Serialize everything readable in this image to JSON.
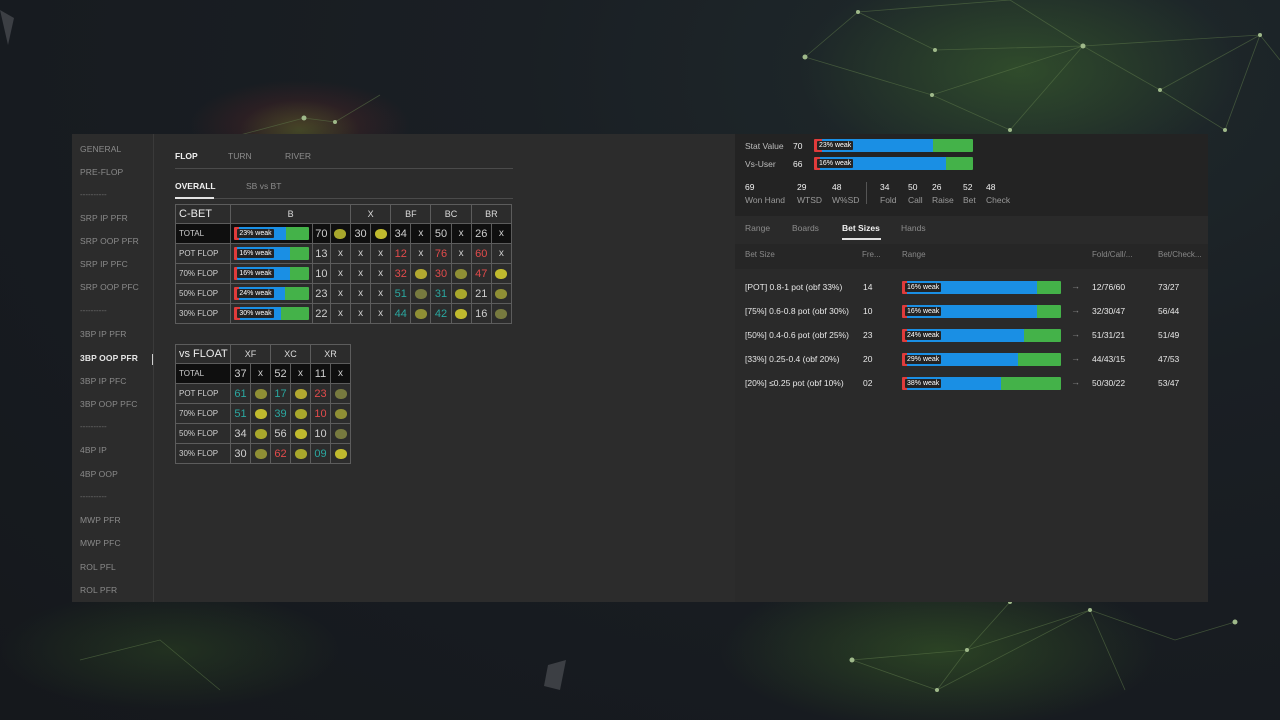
{
  "sidebar": {
    "items": [
      {
        "label": "GENERAL",
        "active": false
      },
      {
        "label": "PRE-FLOP",
        "active": false
      },
      {
        "label": "----------",
        "separator": true
      },
      {
        "label": "SRP IP PFR",
        "active": false
      },
      {
        "label": "SRP OOP PFR",
        "active": false
      },
      {
        "label": "SRP IP PFC",
        "active": false
      },
      {
        "label": "SRP OOP PFC",
        "active": false
      },
      {
        "label": "----------",
        "separator": true
      },
      {
        "label": "3BP IP PFR",
        "active": false
      },
      {
        "label": "3BP OOP PFR",
        "active": true
      },
      {
        "label": "3BP IP PFC",
        "active": false
      },
      {
        "label": "3BP OOP PFC",
        "active": false
      },
      {
        "label": "----------",
        "separator": true
      },
      {
        "label": "4BP IP",
        "active": false
      },
      {
        "label": "4BP OOP",
        "active": false
      },
      {
        "label": "----------",
        "separator": true
      },
      {
        "label": "MWP PFR",
        "active": false
      },
      {
        "label": "MWP PFC",
        "active": false
      },
      {
        "label": "ROL PFL",
        "active": false
      },
      {
        "label": "ROL PFR",
        "active": false
      }
    ]
  },
  "street_tabs": [
    "FLOP",
    "TURN",
    "RIVER"
  ],
  "active_street": "FLOP",
  "sub_tabs": [
    "OVERALL",
    "SB vs BT"
  ],
  "active_sub_tab": "OVERALL",
  "cbet_table": {
    "title": "C-BET",
    "headers": [
      "B",
      "X",
      "BF",
      "BC",
      "BR"
    ],
    "rows": [
      {
        "label": "TOTAL",
        "bar": {
          "text": "23% weak",
          "red": 0.06,
          "blue": 0.63
        },
        "b": "70",
        "x": "30",
        "bf": "34",
        "bc": "50",
        "br": "26"
      },
      {
        "label": "POT FLOP",
        "bar": {
          "text": "16% weak",
          "red": 0.04,
          "blue": 0.71
        },
        "b": "13",
        "x": "x",
        "bf": "12",
        "bc": "76",
        "br": "60"
      },
      {
        "label": "70% FLOP",
        "bar": {
          "text": "16% weak",
          "red": 0.04,
          "blue": 0.71
        },
        "b": "10",
        "x": "x",
        "bf": "32",
        "bc": "30",
        "br": "47"
      },
      {
        "label": "50% FLOP",
        "bar": {
          "text": "24% weak",
          "red": 0.06,
          "blue": 0.62
        },
        "b": "23",
        "x": "x",
        "bf": "51",
        "bc": "31",
        "br": "21"
      },
      {
        "label": "30% FLOP",
        "bar": {
          "text": "30% weak",
          "red": 0.08,
          "blue": 0.55
        },
        "b": "22",
        "x": "x",
        "bf": "44",
        "bc": "42",
        "br": "16"
      }
    ]
  },
  "float_table": {
    "title": "vs FLOAT",
    "headers": [
      "XF",
      "XC",
      "XR"
    ],
    "rows": [
      {
        "label": "TOTAL",
        "xf": "37",
        "xc": "52",
        "xr": "11"
      },
      {
        "label": "POT FLOP",
        "xf": "61",
        "xc": "17",
        "xr": "23"
      },
      {
        "label": "70% FLOP",
        "xf": "51",
        "xc": "39",
        "xr": "10"
      },
      {
        "label": "50% FLOP",
        "xf": "34",
        "xc": "56",
        "xr": "10"
      },
      {
        "label": "30% FLOP",
        "xf": "30",
        "xc": "62",
        "xr": "09"
      }
    ],
    "x_mark": "x"
  },
  "stats": {
    "stat_value": {
      "label": "Stat Value",
      "value": "70",
      "bar": {
        "text": "23% weak",
        "red": 0.05,
        "blue": 0.7
      }
    },
    "vs_user": {
      "label": "Vs-User",
      "value": "66",
      "bar": {
        "text": "16% weak",
        "red": 0.04,
        "blue": 0.79
      }
    },
    "summary": [
      {
        "value": "69",
        "label": "Won Hand"
      },
      {
        "value": "29",
        "label": "WTSD"
      },
      {
        "value": "48",
        "label": "W%SD"
      },
      {
        "value": "34",
        "label": "Fold"
      },
      {
        "value": "50",
        "label": "Call"
      },
      {
        "value": "26",
        "label": "Raise"
      },
      {
        "value": "52",
        "label": "Bet"
      },
      {
        "value": "48",
        "label": "Check"
      }
    ]
  },
  "right_tabs": [
    "Range",
    "Boards",
    "Bet Sizes",
    "Hands"
  ],
  "active_right_tab": "Bet Sizes",
  "bet_sizes": {
    "columns": {
      "bet_size": "Bet Size",
      "freq": "Fre...",
      "range": "Range",
      "fold_call": "Fold/Call/...",
      "bet_check": "Bet/Check..."
    },
    "rows": [
      {
        "size": "[POT] 0.8-1 pot (obf 33%)",
        "freq": "14",
        "bar": {
          "text": "16% weak",
          "red": 0.03,
          "blue": 0.82
        },
        "fcr": "12/76/60",
        "bc": "73/27"
      },
      {
        "size": "[75%] 0.6-0.8 pot (obf 30%)",
        "freq": "10",
        "bar": {
          "text": "16% weak",
          "red": 0.03,
          "blue": 0.82
        },
        "fcr": "32/30/47",
        "bc": "56/44"
      },
      {
        "size": "[50%] 0.4-0.6 pot (obf 25%)",
        "freq": "23",
        "bar": {
          "text": "24% weak",
          "red": 0.03,
          "blue": 0.74
        },
        "fcr": "51/31/21",
        "bc": "51/49"
      },
      {
        "size": "[33%] 0.25-0.4 (obf 20%)",
        "freq": "20",
        "bar": {
          "text": "29% weak",
          "red": 0.03,
          "blue": 0.7
        },
        "fcr": "44/43/15",
        "bc": "47/53"
      },
      {
        "size": "[20%] ≤0.25 pot (obf 10%)",
        "freq": "02",
        "bar": {
          "text": "38% weak",
          "red": 0.03,
          "blue": 0.59
        },
        "fcr": "50/30/22",
        "bc": "53/47"
      }
    ],
    "arrow": "→"
  },
  "colors": {
    "red": "#e03b3b",
    "blue": "#1a8fe4",
    "green": "#44b249",
    "teal": "#2aa7a0",
    "accent_red": "#e24b4b"
  }
}
